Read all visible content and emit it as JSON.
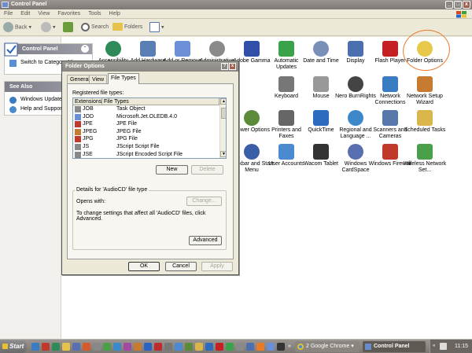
{
  "window": {
    "title": "Control Panel",
    "min_label": "_",
    "max_label": "□",
    "close_label": "x"
  },
  "menu": [
    "File",
    "Edit",
    "View",
    "Favorites",
    "Tools",
    "Help"
  ],
  "toolbar": {
    "back_label": "Back",
    "search_label": "Search",
    "folders_label": "Folders"
  },
  "sidebar": {
    "control_panel_title": "Control Panel",
    "switch_label": "Switch to Category View",
    "see_also_title": "See Also",
    "see_also_items": [
      "Windows Update",
      "Help and Support"
    ]
  },
  "cp_items": [
    {
      "label": "Accessibility Options",
      "icon": "accessibility-icon",
      "color": "#2e8b57"
    },
    {
      "label": "Add Hardware",
      "icon": "add-hardware-icon",
      "color": "#5a7fb5"
    },
    {
      "label": "Add or Remove Programs",
      "icon": "add-remove-programs-icon",
      "color": "#6b8fd6"
    },
    {
      "label": "Administrative Tools",
      "icon": "administrative-tools-icon",
      "color": "#8a8a8a"
    },
    {
      "label": "Adobe Gamma",
      "icon": "adobe-gamma-icon",
      "color": "#2f4fa8"
    },
    {
      "label": "Automatic Updates",
      "icon": "automatic-updates-icon",
      "color": "#3aa34a"
    },
    {
      "label": "Date and Time",
      "icon": "date-time-icon",
      "color": "#7a8fb8"
    },
    {
      "label": "Display",
      "icon": "display-icon",
      "color": "#4c6fb0"
    },
    {
      "label": "Flash Player",
      "icon": "flash-player-icon",
      "color": "#c42222"
    },
    {
      "label": "Folder Options",
      "icon": "folder-options-icon",
      "color": "#e8c84a"
    },
    {
      "label": "Keyboard",
      "icon": "keyboard-icon",
      "color": "#777777"
    },
    {
      "label": "Mouse",
      "icon": "mouse-icon",
      "color": "#999999"
    },
    {
      "label": "Nero BurnRights",
      "icon": "nero-burnrights-icon",
      "color": "#444444"
    },
    {
      "label": "Network Connections",
      "icon": "network-connections-icon",
      "color": "#3a7cc2"
    },
    {
      "label": "Network Setup Wizard",
      "icon": "network-setup-wizard-icon",
      "color": "#c77b30"
    },
    {
      "label": "Power Options",
      "icon": "power-options-icon",
      "color": "#5a8a3a"
    },
    {
      "label": "Printers and Faxes",
      "icon": "printers-faxes-icon",
      "color": "#666666"
    },
    {
      "label": "QuickTime",
      "icon": "quicktime-icon",
      "color": "#2c6bbd"
    },
    {
      "label": "Regional and Language ...",
      "icon": "regional-language-icon",
      "color": "#3d88c9"
    },
    {
      "label": "Scanners and Cameras",
      "icon": "scanners-cameras-icon",
      "color": "#5577aa"
    },
    {
      "label": "Scheduled Tasks",
      "icon": "scheduled-tasks-icon",
      "color": "#d9b54a"
    },
    {
      "label": "Taskbar and Start Menu",
      "icon": "taskbar-start-menu-icon",
      "color": "#3a5fa8"
    },
    {
      "label": "User Accounts",
      "icon": "user-accounts-icon",
      "color": "#4a8bd0"
    },
    {
      "label": "Wacom Tablet",
      "icon": "wacom-tablet-icon",
      "color": "#333333"
    },
    {
      "label": "Windows CardSpace",
      "icon": "windows-cardspace-icon",
      "color": "#5a6fb0"
    },
    {
      "label": "Windows Firewall",
      "icon": "windows-firewall-icon",
      "color": "#c0392b"
    },
    {
      "label": "Wireless Network Set...",
      "icon": "wireless-network-setup-icon",
      "color": "#4aa04a"
    }
  ],
  "dialog": {
    "title": "Folder Options",
    "help_label": "?",
    "close_label": "x",
    "tabs": [
      "General",
      "View",
      "File Types"
    ],
    "registered_label": "Registered file types:",
    "columns": [
      "Extensions",
      "File Types"
    ],
    "rows": [
      {
        "ext": "JOB",
        "type": "Task Object"
      },
      {
        "ext": "JOD",
        "type": "Microsoft.Jet.OLEDB.4.0"
      },
      {
        "ext": "JPE",
        "type": "JPE File"
      },
      {
        "ext": "JPEG",
        "type": "JPEG File"
      },
      {
        "ext": "JPG",
        "type": "JPG File"
      },
      {
        "ext": "JS",
        "type": "JScript Script File"
      },
      {
        "ext": "JSE",
        "type": "JScript Encoded Script File"
      }
    ],
    "new_label": "New",
    "delete_label": "Delete",
    "details_title": "Details for 'AudioCD' file type",
    "opens_with_label": "Opens with:",
    "change_label": "Change...",
    "details_text": "To change settings that affect all 'AudioCD' files, click Advanced.",
    "advanced_label": "Advanced",
    "ok_label": "OK",
    "cancel_label": "Cancel",
    "apply_label": "Apply"
  },
  "taskbar": {
    "start_label": "Start",
    "chrome_label": "2 Google Chrome",
    "control_panel_label": "Control Panel",
    "clock": "11:15"
  }
}
